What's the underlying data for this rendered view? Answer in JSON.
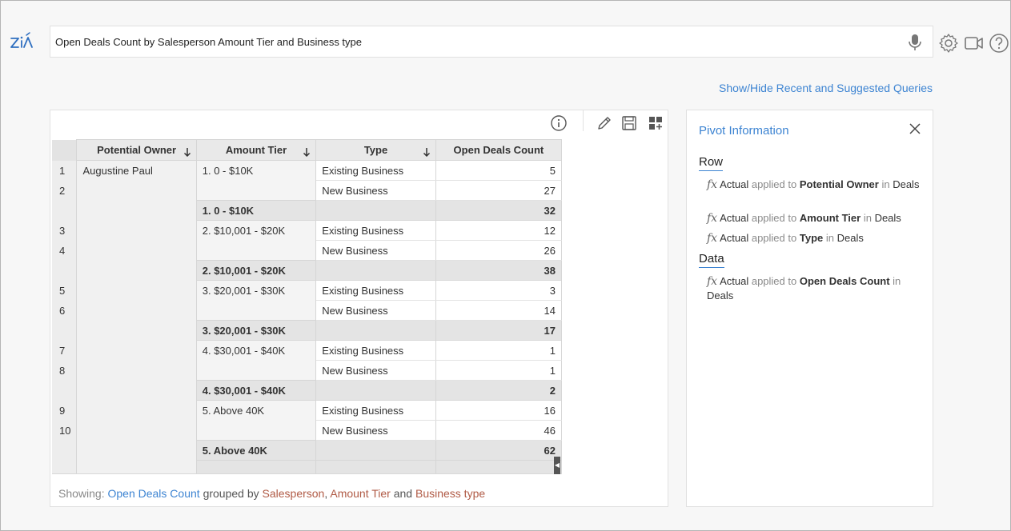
{
  "query": {
    "text": "Open Deals Count by Salesperson Amount Tier and Business type"
  },
  "links": {
    "suggestions": "Show/Hide Recent and Suggested Queries"
  },
  "table": {
    "headers": [
      "Potential Owner",
      "Amount Tier",
      "Type",
      "Open Deals Count"
    ],
    "owner": "Augustine Paul",
    "rows": [
      {
        "n": "1",
        "tier": "1. 0 - $10K",
        "type": "Existing Business",
        "count": "5"
      },
      {
        "n": "2",
        "tier": "",
        "type": "New Business",
        "count": "27"
      },
      {
        "subtotal_label": "1. 0 - $10K",
        "subtotal": "32"
      },
      {
        "n": "3",
        "tier": "2. $10,001 - $20K",
        "type": "Existing Business",
        "count": "12"
      },
      {
        "n": "4",
        "tier": "",
        "type": "New Business",
        "count": "26"
      },
      {
        "subtotal_label": "2. $10,001 - $20K",
        "subtotal": "38"
      },
      {
        "n": "5",
        "tier": "3. $20,001 - $30K",
        "type": "Existing Business",
        "count": "3"
      },
      {
        "n": "6",
        "tier": "",
        "type": "New Business",
        "count": "14"
      },
      {
        "subtotal_label": "3. $20,001 - $30K",
        "subtotal": "17"
      },
      {
        "n": "7",
        "tier": "4. $30,001 - $40K",
        "type": "Existing Business",
        "count": "1"
      },
      {
        "n": "8",
        "tier": "",
        "type": "New Business",
        "count": "1"
      },
      {
        "subtotal_label": "4. $30,001 - $40K",
        "subtotal": "2"
      },
      {
        "n": "9",
        "tier": "5. Above 40K",
        "type": "Existing Business",
        "count": "16"
      },
      {
        "n": "10",
        "tier": "",
        "type": "New Business",
        "count": "46"
      },
      {
        "subtotal_label": "5. Above 40K",
        "subtotal": "62"
      }
    ]
  },
  "showing": {
    "prefix": "Showing:",
    "measure": "Open Deals Count",
    "grouped_by": "grouped by",
    "dim1": "Salesperson",
    "sep": ",",
    "dim2": "Amount Tier",
    "and": "and",
    "dim3": "Business type"
  },
  "pivot": {
    "title": "Pivot Information",
    "row_label": "Row",
    "data_label": "Data",
    "fx_symbol": "fx",
    "actual": "Actual",
    "applied_to": "applied to",
    "in": "in",
    "row_items": [
      {
        "field": "Potential Owner",
        "module": "Deals"
      },
      {
        "field": "Amount Tier",
        "module": "Deals"
      },
      {
        "field": "Type",
        "module": "Deals"
      }
    ],
    "data_items": [
      {
        "field": "Open Deals Count",
        "module": "Deals"
      }
    ]
  },
  "colors": {
    "accent": "#3d84d2",
    "dimension": "#b05a45"
  }
}
